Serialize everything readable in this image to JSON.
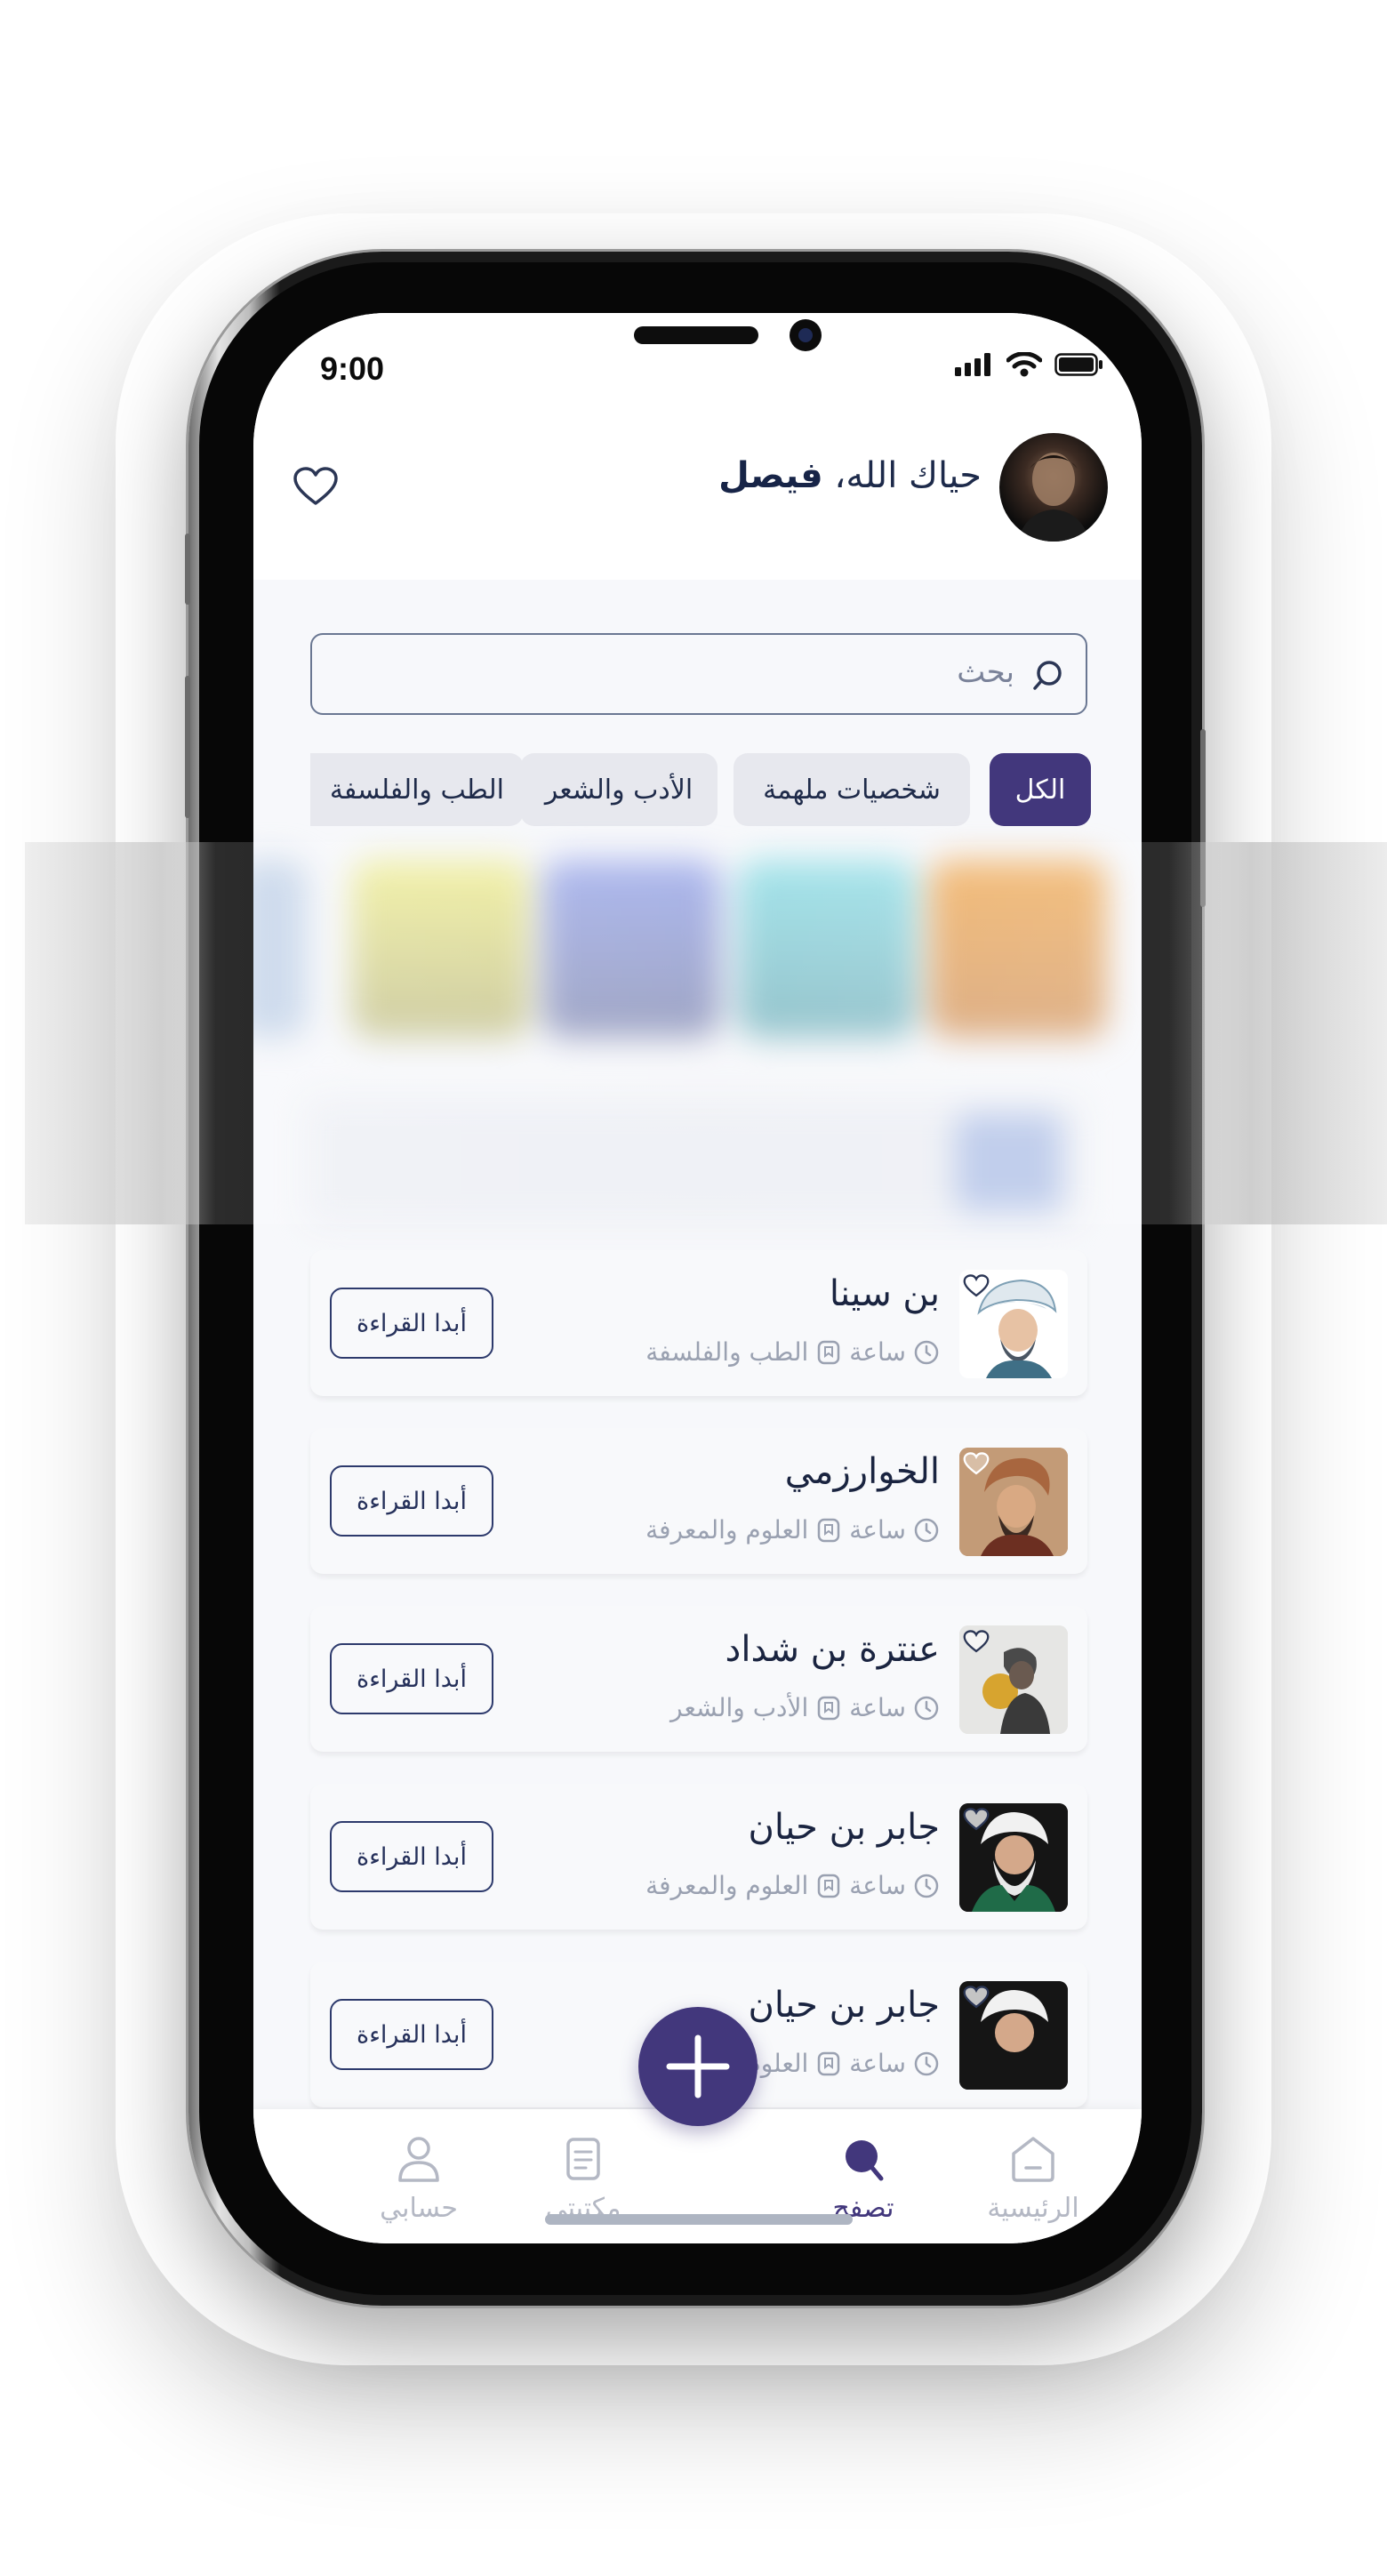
{
  "status": {
    "time": "9:00"
  },
  "header": {
    "greeting_prefix": "حياك الله،",
    "user_name": "فيصل"
  },
  "search": {
    "placeholder": "بحث"
  },
  "categories": [
    "الكل",
    "شخصيات ملهمة",
    "الأدب والشعر",
    "الطب والفلسفة"
  ],
  "stories": [
    {
      "name": "بن سينا",
      "duration": "ساعة",
      "category": "الطب والفلسفة",
      "button": "أبدا القراءة"
    },
    {
      "name": "الخوارزمي",
      "duration": "ساعة",
      "category": "العلوم والمعرفة",
      "button": "أبدا القراءة"
    },
    {
      "name": "عنترة بن شداد",
      "duration": "ساعة",
      "category": "الأدب والشعر",
      "button": "أبدا القراءة"
    },
    {
      "name": "جابر بن حيان",
      "duration": "ساعة",
      "category": "العلوم والمعرفة",
      "button": "أبدا القراءة"
    },
    {
      "name": "جابر بن حيان",
      "duration": "ساعة",
      "category": "العلوم والمعرفة",
      "button": "أبدا القراءة"
    }
  ],
  "tabs": {
    "home": "الرئيسية",
    "browse": "تصفح",
    "library": "مكتبتي",
    "account": "حسابي"
  },
  "colors": {
    "primary": "#42377c",
    "text_dark": "#1a2440",
    "muted": "#9aa1b1",
    "chip_bg": "#e7e8ee"
  }
}
